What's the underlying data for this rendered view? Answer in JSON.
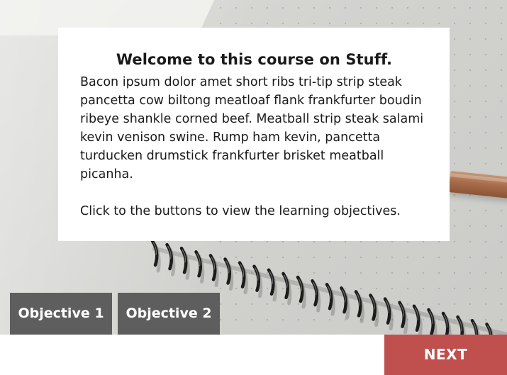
{
  "card": {
    "title": "Welcome to this course on Stuff.",
    "body": "Bacon ipsum dolor amet short ribs tri-tip strip steak pancetta cow biltong meatloaf flank frankfurter boudin ribeye shankle corned beef. Meatball strip steak salami kevin venison swine. Rump ham kevin, pancetta turducken drumstick frankfurter brisket meatball picanha.",
    "instruction": "Click to the buttons to view the learning objectives."
  },
  "objectives": {
    "button_1_label": "Objective 1",
    "button_2_label": "Objective 2"
  },
  "navigation": {
    "next_label": "NEXT"
  },
  "colors": {
    "objective_button": "#5e5e5e",
    "next_button": "#c0504d",
    "card_background": "#ffffff",
    "text": "#1a1a1a"
  },
  "background_image": {
    "subject": "spiral notebook with pencil on desk"
  }
}
